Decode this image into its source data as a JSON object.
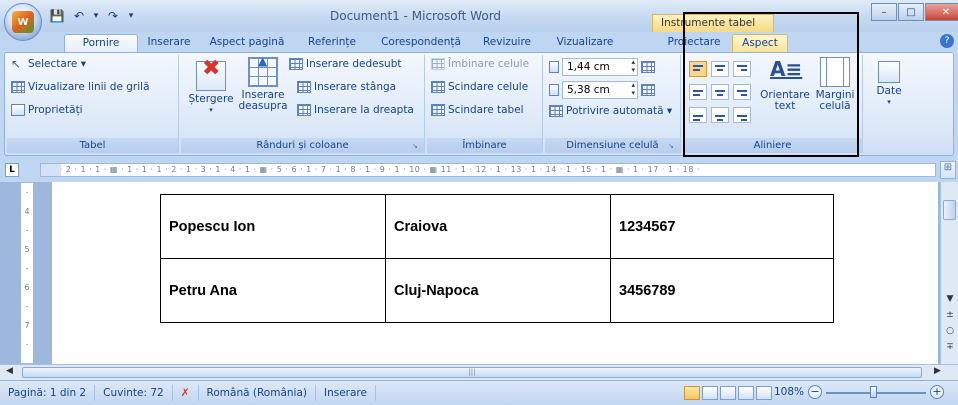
{
  "window": {
    "title": "Document1 - Microsoft Word",
    "context_title": "Instrumente tabel",
    "controls": {
      "minimize": "–",
      "maximize": "□",
      "close": "✕"
    }
  },
  "quick_access": {
    "save_icon": "💾",
    "undo_icon": "↶",
    "undo_dropdown": "▾",
    "redo_icon": "↷",
    "customize_icon": "▾"
  },
  "office_button": {
    "logo": "W"
  },
  "tabs": [
    {
      "label": "Pornire"
    },
    {
      "label": "Inserare"
    },
    {
      "label": "Aspect pagină"
    },
    {
      "label": "Referințe"
    },
    {
      "label": "Corespondență"
    },
    {
      "label": "Revizuire"
    },
    {
      "label": "Vizualizare"
    },
    {
      "label": "Proiectare"
    },
    {
      "label": "Aspect"
    }
  ],
  "ribbon": {
    "tabel": {
      "label": "Tabel",
      "select": "Selectare ▾",
      "gridlines": "Vizualizare linii de grilă",
      "properties": "Proprietăți"
    },
    "rows_cols": {
      "label": "Rânduri și coloane",
      "delete": "Ștergere",
      "insert_above_1": "Inserare",
      "insert_above_2": "deasupra",
      "insert_below": "Inserare dedesubt",
      "insert_left": "Inserare stânga",
      "insert_right": "Inserare la dreapta"
    },
    "merge": {
      "label": "Îmbinare",
      "merge_cells": "Îmbinare celule",
      "split_cells": "Scindare celule",
      "split_table": "Scindare tabel"
    },
    "cell_size": {
      "label": "Dimensiune celulă",
      "height": "1,44 cm",
      "width": "5,38 cm",
      "autofit": "Potrivire automată ▾"
    },
    "alignment": {
      "label": "Aliniere",
      "text_direction_1": "Orientare",
      "text_direction_2": "text",
      "cell_margins_1": "Margini",
      "cell_margins_2": "celulă"
    },
    "data": {
      "label": "Date"
    }
  },
  "ruler": {
    "tab_selector": "L",
    "marks": "1 · 2 · 1 · 1 · ▦ · 1 · 1 · 1 · 2 · 1 · 3 · 1 · 4 · 1 · ▦ · 5 · 6 · 1 · 7 · 1 · 8 · 1 · 9 · 1 · 10 · ▦ 11 · 1 · 12 · 1 · 13 · 1 · 14 · 1 · 15 · 1 · ▦ · 1 · 17 · 1 · 18 ·",
    "vertical_marks": [
      "-",
      "4",
      "-",
      "5",
      "-",
      "6",
      "-",
      "7",
      "-"
    ]
  },
  "table": {
    "rows": [
      [
        "Popescu Ion",
        "Craiova",
        "1234567"
      ],
      [
        "Petru Ana",
        "Cluj-Napoca",
        "3456789"
      ]
    ]
  },
  "status": {
    "page": "Pagină: 1 din 2",
    "words": "Cuvinte: 72",
    "language": "Română (România)",
    "mode": "Inserare",
    "zoom": "108%"
  }
}
